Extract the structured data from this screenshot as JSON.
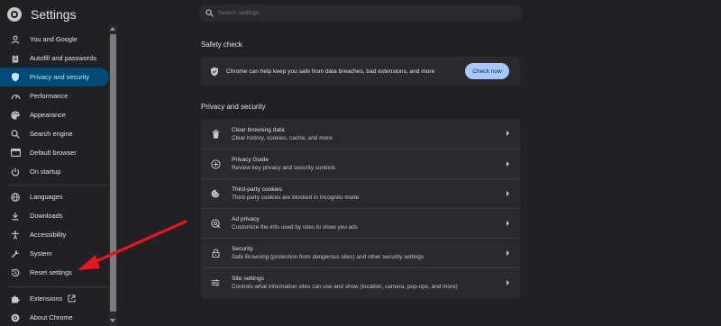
{
  "app": {
    "title": "Settings",
    "logo_icon": "chrome-logo-icon"
  },
  "search": {
    "placeholder": "Search settings"
  },
  "sidebar": {
    "items": [
      {
        "label": "You and Google",
        "icon": "google-g-icon"
      },
      {
        "label": "Autofill and passwords",
        "icon": "clipboard-icon"
      },
      {
        "label": "Privacy and security",
        "icon": "shield-icon",
        "active": true
      },
      {
        "label": "Performance",
        "icon": "speedometer-icon"
      },
      {
        "label": "Appearance",
        "icon": "palette-icon"
      },
      {
        "label": "Search engine",
        "icon": "search-icon"
      },
      {
        "label": "Default browser",
        "icon": "browser-icon"
      },
      {
        "label": "On startup",
        "icon": "power-icon"
      },
      {
        "label": "Languages",
        "icon": "globe-icon"
      },
      {
        "label": "Downloads",
        "icon": "download-icon"
      },
      {
        "label": "Accessibility",
        "icon": "accessibility-icon"
      },
      {
        "label": "System",
        "icon": "wrench-icon"
      },
      {
        "label": "Reset settings",
        "icon": "history-icon"
      },
      {
        "label": "Extensions",
        "icon": "puzzle-icon",
        "external_icon": "open-in-new-icon"
      },
      {
        "label": "About Chrome",
        "icon": "chrome-logo-icon"
      }
    ]
  },
  "safety_check": {
    "heading": "Safety check",
    "text": "Chrome can help keep you safe from data breaches, bad extensions, and more",
    "button": "Check now"
  },
  "privacy": {
    "heading": "Privacy and security",
    "rows": [
      {
        "title": "Clear browsing data",
        "subtitle": "Clear history, cookies, cache, and more",
        "icon": "trash-icon"
      },
      {
        "title": "Privacy Guide",
        "subtitle": "Review key privacy and security controls",
        "icon": "compass-plus-icon"
      },
      {
        "title": "Third-party cookies",
        "subtitle": "Third-party cookies are blocked in Incognito mode",
        "icon": "cookie-icon"
      },
      {
        "title": "Ad privacy",
        "subtitle": "Customize the info used by sites to show you ads",
        "icon": "ad-privacy-icon"
      },
      {
        "title": "Security",
        "subtitle": "Safe Browsing (protection from dangerous sites) and other security settings",
        "icon": "lock-icon"
      },
      {
        "title": "Site settings",
        "subtitle": "Controls what information sites can use and show (location, camera, pop-ups, and more)",
        "icon": "sliders-icon"
      }
    ]
  },
  "colors": {
    "background": "#202124",
    "card": "#282a2d",
    "active_nav": "#004a77",
    "button": "#a8c7fa",
    "annotation_arrow": "#e8141b"
  }
}
